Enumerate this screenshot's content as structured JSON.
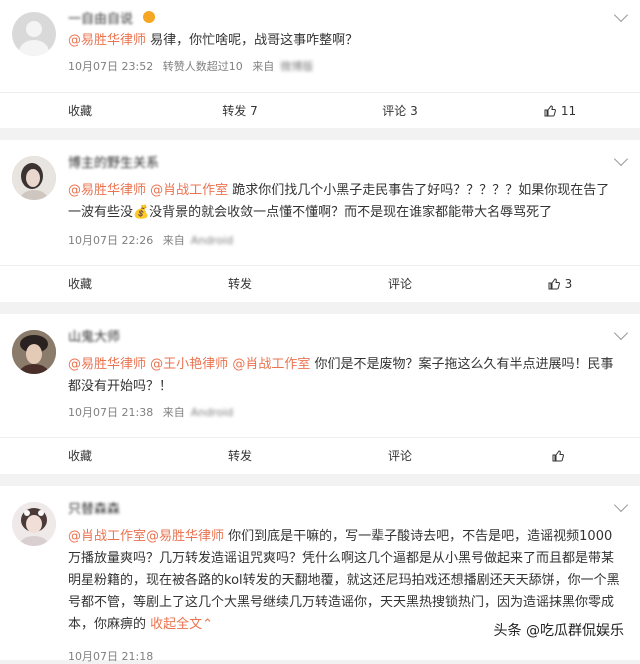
{
  "comments": [
    {
      "username": "一自由自说",
      "mentions": [
        "@易胜华律师"
      ],
      "text": " 易律，你忙啥呢，战哥这事咋整啊？",
      "name_in_text": "易",
      "date": "10月07日 23:52",
      "reposts_text": "转赞人数超过10",
      "source_prefix": "来自",
      "source_device": "微博版",
      "actions": {
        "fav": "收藏",
        "repost": "转发 7",
        "comment": "评论 3",
        "like": "11"
      }
    },
    {
      "username": "博主的野生关系",
      "mentions": [
        "@易胜华律师",
        "@肖战工作室"
      ],
      "text": " 跪求你们找几个小黑子走民事告了好吗？？？？？如果你现在告了一波有些没💰没背景的就会收敛一点懂不懂啊？而不是现在谁家都能带大名辱骂死了",
      "date": "10月07日 22:26",
      "source_prefix": "来自",
      "source_device": "Android",
      "actions": {
        "fav": "收藏",
        "repost": "转发",
        "comment": "评论",
        "like": "3"
      }
    },
    {
      "username": "山鬼大师",
      "mentions": [
        "@易胜华律师",
        "@王小艳律师",
        "@肖战工作室"
      ],
      "text": " 你们是不是废物？案子拖这么久有半点进展吗！民事都没有开始吗？！",
      "date": "10月07日 21:38",
      "source_prefix": "来自",
      "source_device": "Android",
      "actions": {
        "fav": "收藏",
        "repost": "转发",
        "comment": "评论",
        "like": ""
      }
    },
    {
      "username": "只替森森",
      "mentions": [
        "@肖战工作室",
        "@易胜华律师"
      ],
      "text": " 你们到底是干嘛的，写一辈子酸诗去吧，不告是吧，造谣视频1000万播放量爽吗？几万转发造谣诅咒爽吗？凭什么啊这几个逼都是从小黑号做起来了而且都是带某明星粉籍的，现在被各路的kol转发的天翻地覆，就这还尼玛拍戏还想播剧还天天舔饼，你一个黑号都不管，等剧上了这几个大黑号继续几万转造谣你，天天黑热搜锁热门，因为造谣抹黑你零成本，你麻痹的",
      "expand": "收起全文",
      "date": "10月07日 21:18"
    }
  ],
  "watermark": "头条 @吃瓜群侃娱乐",
  "colors": {
    "link": "#eb7350",
    "meta": "#808080",
    "background": "#f2f2f2"
  }
}
